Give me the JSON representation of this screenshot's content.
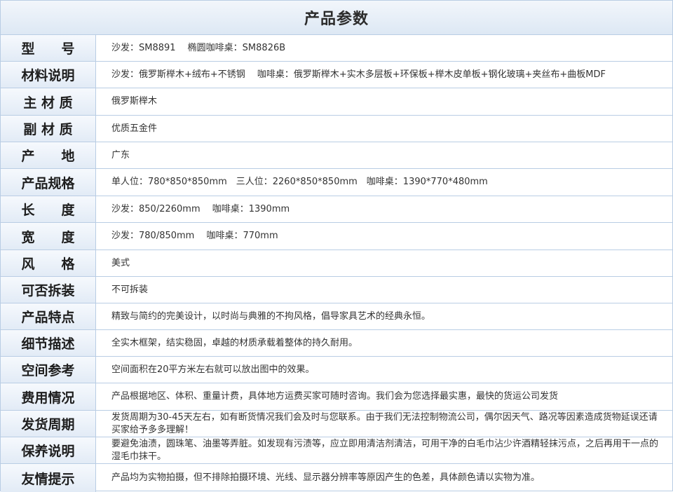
{
  "title": "产品参数",
  "rows": [
    {
      "label": "型　　号",
      "value": "沙发：SM8891　 椭圆咖啡桌：SM8826B"
    },
    {
      "label": "材料说明",
      "value": "沙发：俄罗斯榉木+绒布+不锈钢　 咖啡桌：俄罗斯榉木+实木多层板+环保板+榉木皮单板+钢化玻璃+夹丝布+曲板MDF"
    },
    {
      "label": "主 材 质",
      "value": "俄罗斯榉木"
    },
    {
      "label": "副 材 质",
      "value": "优质五金件"
    },
    {
      "label": "产　　地",
      "value": "广东"
    },
    {
      "label": "产品规格",
      "value": "单人位：780*850*850mm　三人位：2260*850*850mm　咖啡桌：1390*770*480mm"
    },
    {
      "label": "长　　度",
      "value": "沙发：850/2260mm　 咖啡桌：1390mm"
    },
    {
      "label": "宽　　度",
      "value": "沙发：780/850mm　 咖啡桌：770mm"
    },
    {
      "label": "风　　格",
      "value": "美式"
    },
    {
      "label": "可否拆装",
      "value": "不可拆装"
    },
    {
      "label": "产品特点",
      "value": "精致与简约的完美设计，以时尚与典雅的不拘风格，倡导家具艺术的经典永恒。"
    },
    {
      "label": "细节描述",
      "value": "全实木框架，结实稳固，卓越的材质承载着整体的持久耐用。"
    },
    {
      "label": "空间参考",
      "value": "空间面积在20平方米左右就可以放出图中的效果。"
    },
    {
      "label": "费用情况",
      "value": "产品根据地区、体积、重量计费，具体地方运费买家可随时咨询。我们会为您选择最实惠，最快的货运公司发货"
    },
    {
      "label": "发货周期",
      "value": "发货周期为30-45天左右，如有断货情况我们会及时与您联系。由于我们无法控制物流公司，偶尔因天气、路况等因素造成货物延误还请买家给予多多理解！"
    },
    {
      "label": "保养说明",
      "value": "要避免油渍，圆珠笔、油墨等弄脏。如发现有污渍等，应立即用清洁剂清洁，可用干净的白毛巾沾少许酒精轻抹污点，之后再用干一点的湿毛巾抹干。"
    },
    {
      "label": "友情提示",
      "value": "产品均为实物拍摄，但不排除拍摄环境、光线、显示器分辨率等原因产生的色差，具体颜色请以实物为准。"
    }
  ]
}
